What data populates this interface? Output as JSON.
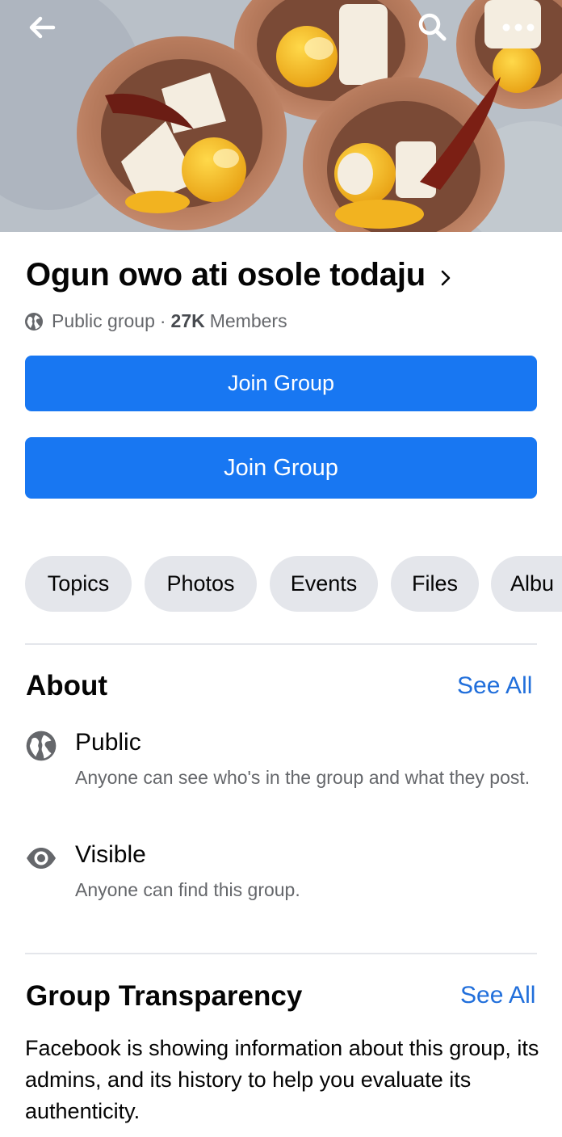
{
  "header": {
    "back_icon": "arrow-left-icon",
    "search_icon": "search-icon",
    "more_icon": "more-dots-icon"
  },
  "group": {
    "name": "Ogun owo ati osole todaju",
    "privacy": "Public group",
    "separator": "·",
    "member_count": "27K",
    "member_label": "Members"
  },
  "buttons": {
    "join_primary": "Join Group",
    "join_secondary": "Join Group"
  },
  "tabs": [
    {
      "label": "Topics"
    },
    {
      "label": "Photos"
    },
    {
      "label": "Events"
    },
    {
      "label": "Files"
    },
    {
      "label": "Albu"
    }
  ],
  "about": {
    "title": "About",
    "see_all": "See All",
    "items": [
      {
        "icon": "globe-icon",
        "title": "Public",
        "description": "Anyone can see who's in the group and what they post."
      },
      {
        "icon": "eye-icon",
        "title": "Visible",
        "description": "Anyone can find this group."
      }
    ]
  },
  "transparency": {
    "title": "Group Transparency",
    "see_all": "See All",
    "description": "Facebook is showing information about this group, its admins, and its history to help you evaluate its authenticity."
  },
  "colors": {
    "primary_blue": "#1877f2",
    "link_blue": "#216fdb",
    "chip_gray": "#e4e6eb",
    "secondary_text": "#65676b"
  }
}
